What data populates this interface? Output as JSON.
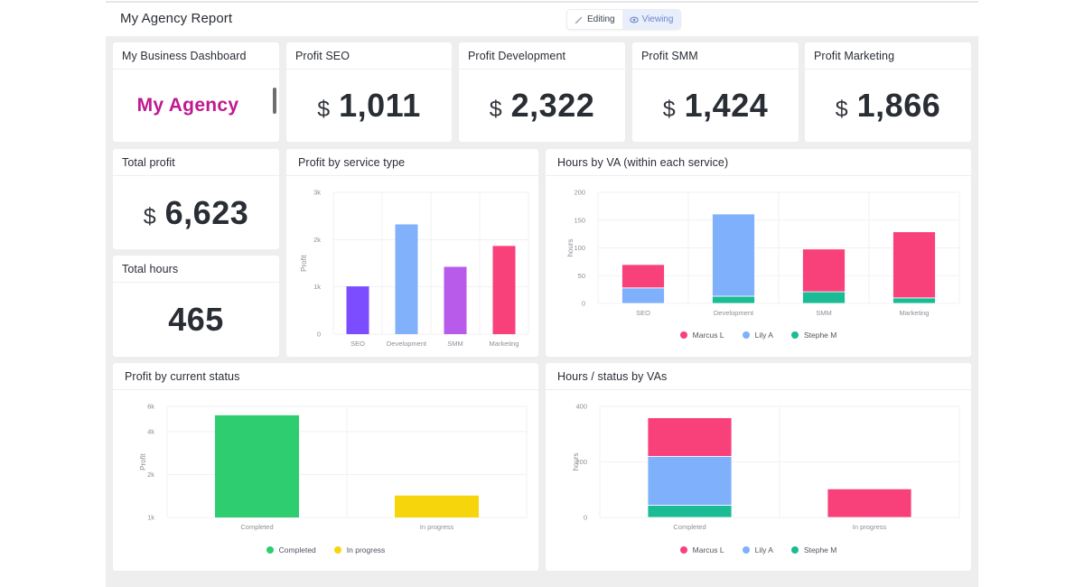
{
  "header": {
    "title": "My Agency Report",
    "modes": [
      {
        "label": "Editing",
        "icon": "pencil-icon",
        "active": false
      },
      {
        "label": "Viewing",
        "icon": "eye-icon",
        "active": true
      }
    ]
  },
  "widgets": {
    "business": {
      "title": "My Business Dashboard",
      "logo_text": "My Agency",
      "logo_color": "#c0188f"
    },
    "profit_seo": {
      "title": "Profit SEO",
      "currency": "$",
      "value": "1,011"
    },
    "profit_dev": {
      "title": "Profit Development",
      "currency": "$",
      "value": "2,322"
    },
    "profit_smm": {
      "title": "Profit SMM",
      "currency": "$",
      "value": "1,424"
    },
    "profit_marketing": {
      "title": "Profit Marketing",
      "currency": "$",
      "value": "1,866"
    },
    "total_profit": {
      "title": "Total profit",
      "currency": "$",
      "value": "6,623"
    },
    "total_hours": {
      "title": "Total hours",
      "value": "465"
    }
  },
  "colors": {
    "marcus": "#f8417a",
    "lily": "#7fb0fb",
    "stephe": "#1bbc95",
    "seo": "#7c4dff",
    "development": "#81b1fa",
    "smm": "#b85aea",
    "marketing": "#f8417a",
    "completed": "#2ecd6f",
    "in_progress": "#f7d50c"
  },
  "chart_data": [
    {
      "id": "profit_by_service",
      "type": "bar",
      "title": "Profit by service type",
      "xlabel": "",
      "ylabel": "Profit",
      "categories": [
        "SEO",
        "Development",
        "SMM",
        "Marketing"
      ],
      "values": [
        1011,
        2322,
        1424,
        1866
      ],
      "bar_colors": [
        "#7c4dff",
        "#81b1fa",
        "#b85aea",
        "#f8417a"
      ],
      "ylim": [
        0,
        3000
      ],
      "yticks": [
        0,
        1000,
        2000,
        3000
      ],
      "ytick_labels": [
        "0",
        "1k",
        "2k",
        "3k"
      ],
      "grid": true,
      "legend": "none"
    },
    {
      "id": "hours_by_va",
      "type": "bar",
      "stacked": true,
      "title": "Hours by VA (within each service)",
      "xlabel": "",
      "ylabel": "hours",
      "categories": [
        "SEO",
        "Development",
        "SMM",
        "Marketing"
      ],
      "series": [
        {
          "name": "Stephe M",
          "color": "#1bbc95",
          "values": [
            0,
            13,
            21,
            10
          ]
        },
        {
          "name": "Lily A",
          "color": "#7fb0fb",
          "values": [
            28,
            148,
            0,
            0
          ]
        },
        {
          "name": "Marcus L",
          "color": "#f8417a",
          "values": [
            42,
            0,
            77,
            119
          ]
        }
      ],
      "legend_order": [
        "Marcus L",
        "Lily A",
        "Stephe M"
      ],
      "ylim": [
        0,
        200
      ],
      "yticks": [
        0,
        50,
        100,
        150,
        200
      ],
      "ytick_labels": [
        "0",
        "50",
        "100",
        "150",
        "200"
      ],
      "grid": true,
      "legend": "bottom"
    },
    {
      "id": "profit_by_status",
      "type": "bar",
      "title": "Profit by current status",
      "xlabel": "",
      "ylabel": "Profit",
      "yscale": "log",
      "categories": [
        "Completed",
        "In progress"
      ],
      "values": [
        5199,
        1424
      ],
      "bar_colors": [
        "#2ecd6f",
        "#f7d50c"
      ],
      "ylim": [
        1000,
        6000
      ],
      "yticks": [
        1000,
        2000,
        4000,
        6000
      ],
      "ytick_labels": [
        "1k",
        "2k",
        "4k",
        "6k"
      ],
      "grid": true,
      "legend": "bottom"
    },
    {
      "id": "hours_status_by_va",
      "type": "bar",
      "stacked": true,
      "title": "Hours / status by VAs",
      "xlabel": "",
      "ylabel": "hours",
      "categories": [
        "Completed",
        "In progress"
      ],
      "series": [
        {
          "name": "Stephe M",
          "color": "#1bbc95",
          "values": [
            44,
            0
          ]
        },
        {
          "name": "Lily A",
          "color": "#7fb0fb",
          "values": [
            176,
            0
          ]
        },
        {
          "name": "Marcus L",
          "color": "#f8417a",
          "values": [
            139,
            103
          ]
        }
      ],
      "legend_order": [
        "Marcus L",
        "Lily A",
        "Stephe M"
      ],
      "ylim": [
        0,
        400
      ],
      "yticks": [
        0,
        200,
        400
      ],
      "ytick_labels": [
        "0",
        "200",
        "400"
      ],
      "grid": true,
      "legend": "bottom"
    }
  ]
}
